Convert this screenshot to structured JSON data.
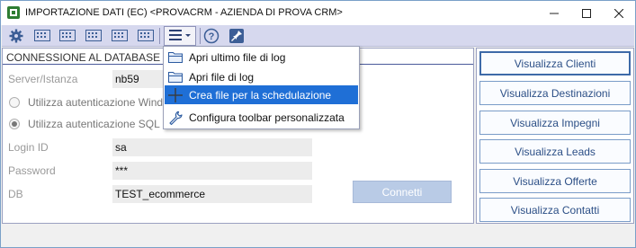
{
  "window": {
    "title": "IMPORTAZIONE DATI (EC) <PROVACRM - AZIENDA DI PROVA CRM>",
    "controls": [
      "minimize",
      "maximize",
      "close"
    ]
  },
  "toolbar": {
    "icons": [
      "settings-icon",
      "grid-icon-1",
      "grid-icon-2",
      "grid-icon-3",
      "grid-icon-4",
      "grid-icon-5",
      "hamburger-menu-icon",
      "help-icon",
      "pin-icon"
    ]
  },
  "connection": {
    "header": "CONNESSIONE AL DATABASE DI T",
    "server_label": "Server/Istanza",
    "server_value": "nb59",
    "radio_windows": "Utilizza autenticazione Windows",
    "radio_sql": "Utilizza autenticazione SQL Serv",
    "login_label": "Login ID",
    "login_value": "sa",
    "password_label": "Password",
    "password_value": "***",
    "db_label": "DB",
    "db_value": "TEST_ecommerce",
    "connect_label": "Connetti"
  },
  "actions": {
    "clienti": "Visualizza Clienti",
    "destinazioni": "Visualizza Destinazioni",
    "impegni": "Visualizza Impegni",
    "leads": "Visualizza Leads",
    "offerte": "Visualizza Offerte",
    "contatti": "Visualizza Contatti"
  },
  "menu": {
    "items": [
      {
        "label": "Apri ultimo file di log",
        "icon": "folder-icon"
      },
      {
        "label": "Apri file di log",
        "icon": "folder-icon"
      },
      {
        "label": "Crea file per la schedulazione",
        "icon": "plus-icon"
      },
      {
        "label": "Configura toolbar personalizzata",
        "icon": "wrench-icon"
      }
    ],
    "highlighted_index": 2
  },
  "colors": {
    "accent": "#1f6fd6",
    "toolbar_bg": "#d6d8ee",
    "button_text": "#2c4f86"
  }
}
